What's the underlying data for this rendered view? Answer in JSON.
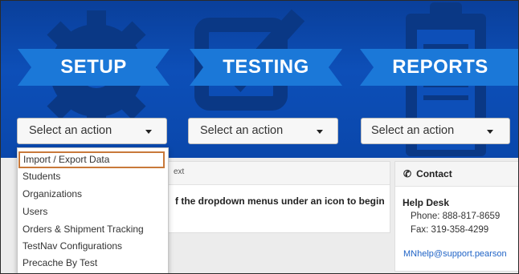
{
  "sections": [
    {
      "title": "SETUP",
      "select_label": "Select an action",
      "icon": "gear-icon"
    },
    {
      "title": "TESTING",
      "select_label": "Select an action",
      "icon": "checkbox-edit-icon"
    },
    {
      "title": "REPORTS",
      "select_label": "Select an action",
      "icon": "clipboard-icon"
    }
  ],
  "dropdown": {
    "items": [
      "Import / Export Data",
      "Students",
      "Organizations",
      "Users",
      "Orders & Shipment Tracking",
      "TestNav Configurations",
      "Precache By Test"
    ],
    "highlighted_index": 0
  },
  "main_panel": {
    "header_fragment": "ext",
    "body_fragment": "f the dropdown menus under an icon to begin"
  },
  "contact": {
    "title": "Contact",
    "icon": "phone-icon",
    "desk": "Help Desk",
    "phone": "Phone: 888-817-8659",
    "fax": "Fax: 319-358-4299",
    "email": "MNhelp@support.pearson"
  },
  "colors": {
    "banner_blue": "#0a47ab",
    "ribbon_blue": "#1b78d8",
    "highlight_border": "#c8793a",
    "link": "#1f63c6"
  }
}
